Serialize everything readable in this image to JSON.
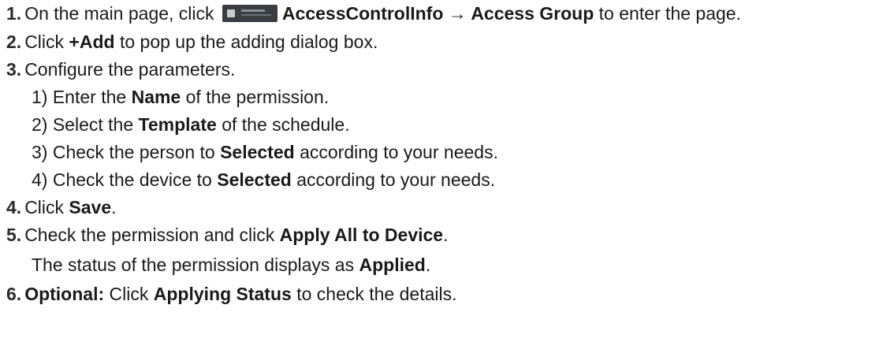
{
  "steps": {
    "s1": {
      "num": "1.",
      "a": "On the main page, click ",
      "b": "AccessControlInfo → Access Group",
      "c": " to enter the page."
    },
    "s2": {
      "num": "2.",
      "a": "Click ",
      "b": "+Add",
      "c": " to pop up the adding dialog box."
    },
    "s3": {
      "num": "3.",
      "a": "Configure the parameters.",
      "sub1": {
        "a": "1) Enter the ",
        "b": "Name",
        "c": " of the permission."
      },
      "sub2": {
        "a": "2) Select the ",
        "b": "Template",
        "c": " of the schedule."
      },
      "sub3": {
        "a": "3) Check the person to ",
        "b": "Selected",
        "c": " according to your needs."
      },
      "sub4": {
        "a": "4) Check the device to ",
        "b": "Selected",
        "c": " according to your needs."
      }
    },
    "s4": {
      "num": "4.",
      "a": "Click ",
      "b": "Save",
      "c": "."
    },
    "s5": {
      "num": "5.",
      "a": "Check the permission and click ",
      "b": "Apply All to Device",
      "c": ".",
      "result": {
        "a": "The status of the permission displays as ",
        "b": "Applied",
        "c": "."
      }
    },
    "s6": {
      "num": "6.",
      "label": "Optional:",
      "a": " Click ",
      "b": "Applying Status",
      "c": " to check the details."
    }
  },
  "icons": {
    "access_control_tile": "access-control-module-icon"
  }
}
